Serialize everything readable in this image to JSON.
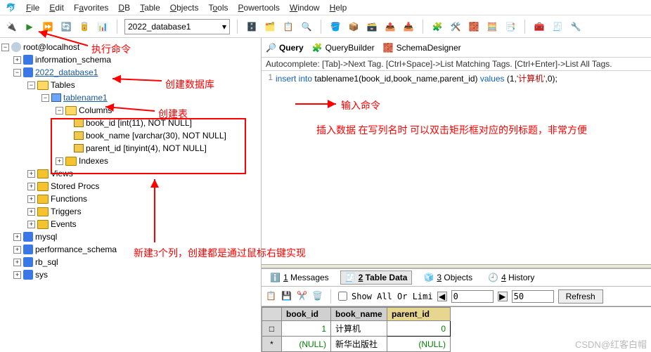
{
  "menu": [
    "File",
    "Edit",
    "Favorites",
    "DB",
    "Table",
    "Objects",
    "Tools",
    "Powertools",
    "Window",
    "Help"
  ],
  "toolbar": {
    "db_selected": "2022_database1"
  },
  "tree": {
    "root": "root@localhost",
    "dbs": [
      {
        "name": "information_schema"
      },
      {
        "name": "2022_database1",
        "open": true,
        "children": [
          {
            "name": "Tables",
            "open": true,
            "children": [
              {
                "name": "tablename1",
                "link": true,
                "open": true,
                "children": [
                  {
                    "name": "Columns",
                    "open": true,
                    "children": [
                      {
                        "name": "book_id [int(11), NOT NULL]"
                      },
                      {
                        "name": "book_name [varchar(30), NOT NULL]"
                      },
                      {
                        "name": "parent_id [tinyint(4), NOT NULL]"
                      }
                    ]
                  },
                  {
                    "name": "Indexes"
                  }
                ]
              }
            ]
          },
          {
            "name": "Views"
          },
          {
            "name": "Stored Procs"
          },
          {
            "name": "Functions"
          },
          {
            "name": "Triggers"
          },
          {
            "name": "Events"
          }
        ]
      },
      {
        "name": "mysql"
      },
      {
        "name": "performance_schema"
      },
      {
        "name": "rb_sql"
      },
      {
        "name": "sys"
      }
    ]
  },
  "tabs": {
    "query": "Query",
    "qb": "QueryBuilder",
    "sd": "SchemaDesigner"
  },
  "autocomplete": "Autocomplete: [Tab]->Next Tag. [Ctrl+Space]->List Matching Tags. [Ctrl+Enter]->List All Tags.",
  "sql": {
    "line": "1",
    "text_insert": "insert into",
    "text_mid": " tablename1(book_id,book_name,parent_id) ",
    "text_values": "values",
    "text_args": " (1,",
    "text_str": "'计算机'",
    "text_end": ",0);"
  },
  "bottom_tabs": {
    "msg": "1 Messages",
    "data": "2 Table Data",
    "obj": "3 Objects",
    "hist": "4 History"
  },
  "databar": {
    "showall": "Show All Or Limi",
    "from": "0",
    "to": "50",
    "refresh": "Refresh"
  },
  "grid": {
    "cols": [
      "book_id",
      "book_name",
      "parent_id"
    ],
    "rows": [
      {
        "hdr": "□",
        "id": "1",
        "name": "计算机",
        "parent": "0"
      },
      {
        "hdr": "*",
        "id": "(NULL)",
        "name": "新华出版社",
        "parent": "(NULL)"
      }
    ]
  },
  "anno": {
    "exec": "执行命令",
    "createdb": "创建数据库",
    "createtbl": "创建表",
    "input": "输入命令",
    "insert": "插入数据  在写列名时  可以双击矩形框对应的列标题，非常方便",
    "newcol": "新建3个列，创建都是通过鼠标右键实现"
  },
  "credit": "CSDN@红客白帽"
}
